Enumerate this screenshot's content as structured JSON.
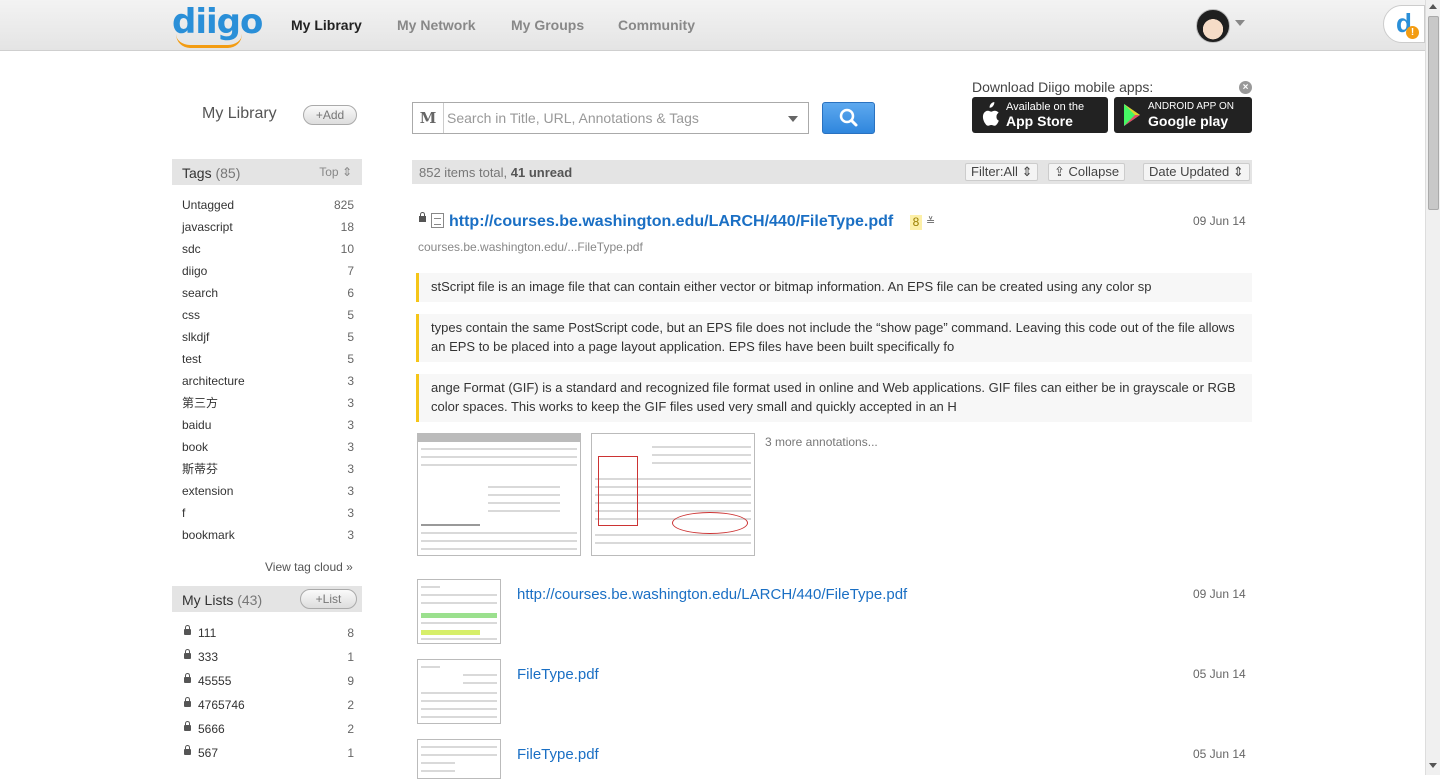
{
  "nav": {
    "logo": "diigo",
    "items": [
      "My Library",
      "My Network",
      "My Groups",
      "Community"
    ],
    "active": "My Library"
  },
  "sidebar": {
    "title": "My Library",
    "add_label": "+Add",
    "tags_header": "Tags",
    "tags_count": "(85)",
    "tags_sort": "Top",
    "tags": [
      {
        "name": "Untagged",
        "count": "825"
      },
      {
        "name": "javascript",
        "count": "18"
      },
      {
        "name": "sdc",
        "count": "10"
      },
      {
        "name": "diigo",
        "count": "7"
      },
      {
        "name": "search",
        "count": "6"
      },
      {
        "name": "css",
        "count": "5"
      },
      {
        "name": "slkdjf",
        "count": "5"
      },
      {
        "name": "test",
        "count": "5"
      },
      {
        "name": "architecture",
        "count": "3"
      },
      {
        "name": "第三方",
        "count": "3"
      },
      {
        "name": "baidu",
        "count": "3"
      },
      {
        "name": "book",
        "count": "3"
      },
      {
        "name": "斯蒂芬",
        "count": "3"
      },
      {
        "name": "extension",
        "count": "3"
      },
      {
        "name": "f",
        "count": "3"
      },
      {
        "name": "bookmark",
        "count": "3"
      }
    ],
    "view_tag_cloud": "View tag cloud »",
    "lists_header": "My Lists",
    "lists_count": "(43)",
    "list_add_label": "+List",
    "lists": [
      {
        "name": "111",
        "count": "8"
      },
      {
        "name": "333",
        "count": "1"
      },
      {
        "name": "45555",
        "count": "9"
      },
      {
        "name": "4765746",
        "count": "2"
      },
      {
        "name": "5666",
        "count": "2"
      },
      {
        "name": "567",
        "count": "1"
      }
    ]
  },
  "search": {
    "mode_label": "M",
    "placeholder": "Search in Title, URL, Annotations & Tags"
  },
  "download": {
    "text": "Download Diigo mobile apps:",
    "close": "×",
    "appstore_line1": "Available on the",
    "appstore_line2": "App Store",
    "googleplay_line1": "ANDROID APP ON",
    "googleplay_line2": "Google play"
  },
  "toolbar": {
    "items_total": "852 items total,",
    "unread": "41 unread",
    "filter": "Filter:All",
    "collapse": "Collapse",
    "sort": "Date Updated"
  },
  "bookmark": {
    "title": "http://courses.be.washington.edu/LARCH/440/FileType.pdf",
    "count": "8",
    "date": "09 Jun 14",
    "url": "courses.be.washington.edu/...FileType.pdf",
    "annotations": [
      "stScript file is an image file that can contain either vector or bitmap information. An EPS file can be created using any color sp",
      "types contain the same PostScript code, but an EPS file does not include the “show page” command. Leaving this code out of the file allows an EPS to be placed into a page layout application. EPS files have been built specifically fo",
      "ange Format (GIF) is a standard and recognized file format used in online and Web applications. GIF files can either be in grayscale or RGB color spaces. This works to keep the GIF files used very small and quickly accepted in an H"
    ],
    "more_annotations": "3 more annotations..."
  },
  "rows": [
    {
      "title": "http://courses.be.washington.edu/LARCH/440/FileType.pdf",
      "date": "09 Jun 14"
    },
    {
      "title": "FileType.pdf",
      "date": "05 Jun 14"
    },
    {
      "title": "FileType.pdf",
      "date": "05 Jun 14"
    }
  ],
  "colors": {
    "accent": "#1a6fc4",
    "highlight": "#f5c518",
    "search_button": "#3a8de0"
  }
}
